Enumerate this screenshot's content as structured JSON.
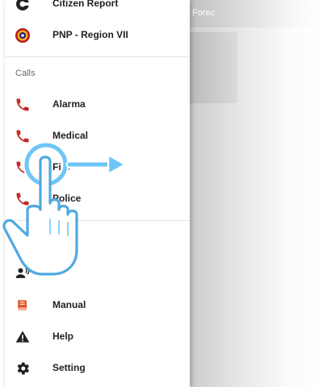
{
  "background": {
    "header_text": "Forec"
  },
  "drawer": {
    "top_items": [
      {
        "label": "Citizen Report",
        "icon": "citizen-report-icon"
      },
      {
        "label": "PNP - Region VII",
        "icon": "pnp-badge-icon"
      }
    ],
    "calls_section_label": "Calls",
    "call_items": [
      {
        "label": "Alarma",
        "icon": "phone-icon"
      },
      {
        "label": "Medical",
        "icon": "phone-icon"
      },
      {
        "label": "Fire",
        "icon": "phone-icon"
      },
      {
        "label": "Police",
        "icon": "phone-icon"
      }
    ],
    "bottom_items": [
      {
        "label": "",
        "icon": "tools-icon"
      },
      {
        "label": "",
        "icon": "speaker-person-icon"
      },
      {
        "label": "Manual",
        "icon": "book-icon"
      },
      {
        "label": "Help",
        "icon": "warning-icon"
      },
      {
        "label": "Setting",
        "icon": "gear-icon"
      }
    ]
  },
  "colors": {
    "call_icon": "#c62828",
    "manual_icon": "#e0592a",
    "gesture_fill": "#6ec6f5"
  }
}
